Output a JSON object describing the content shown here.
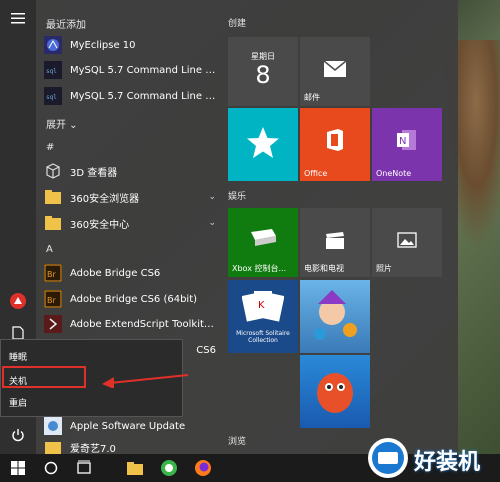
{
  "apps": {
    "recent_header": "最近添加",
    "recent": [
      {
        "label": "MyEclipse 10",
        "icon": "myeclipse-icon"
      },
      {
        "label": "MySQL 5.7 Command Line Client",
        "icon": "mysql-icon"
      },
      {
        "label": "MySQL 5.7 Command Line Client...",
        "icon": "mysql-icon"
      }
    ],
    "expand_label": "展开",
    "hash_header": "#",
    "hash_apps": [
      {
        "label": "3D 查看器",
        "icon": "cube-icon"
      },
      {
        "label": "360安全浏览器",
        "icon": "folder-icon"
      },
      {
        "label": "360安全中心",
        "icon": "folder-icon"
      }
    ],
    "a_header": "A",
    "a_apps": [
      {
        "label": "Adobe Bridge CS6",
        "icon": "bridge-icon"
      },
      {
        "label": "Adobe Bridge CS6 (64bit)",
        "icon": "bridge-icon"
      },
      {
        "label": "Adobe ExtendScript Toolkit CS6",
        "icon": "extendscript-icon"
      },
      {
        "label": "CS6",
        "icon": "app-icon"
      },
      {
        "label": "Apple Software Update",
        "icon": "apple-update-icon"
      },
      {
        "label": "爱奇艺7.0",
        "icon": "folder-icon"
      }
    ]
  },
  "power_menu": {
    "items": [
      "睡眠",
      "关机",
      "重启"
    ]
  },
  "tiles": {
    "create_header": "创建",
    "calendar_day": "星期日",
    "calendar_date": "8",
    "mail_label": "邮件",
    "office_label": "Office",
    "onenote_label": "OneNote",
    "entertainment_header": "娱乐",
    "xbox_label": "Xbox 控制台...",
    "movies_label": "电影和电视",
    "photos_label": "照片",
    "solitaire_label": "Microsoft Solitaire Collection",
    "browse_header": "浏览"
  },
  "watermark": {
    "text": "好装机"
  },
  "colors": {
    "teal": "#00b4c4",
    "orange": "#e8491d",
    "purple": "#7c34ad",
    "green": "#107c10",
    "gray_tile": "#4a4a4a",
    "highlight": "#e0302a"
  }
}
